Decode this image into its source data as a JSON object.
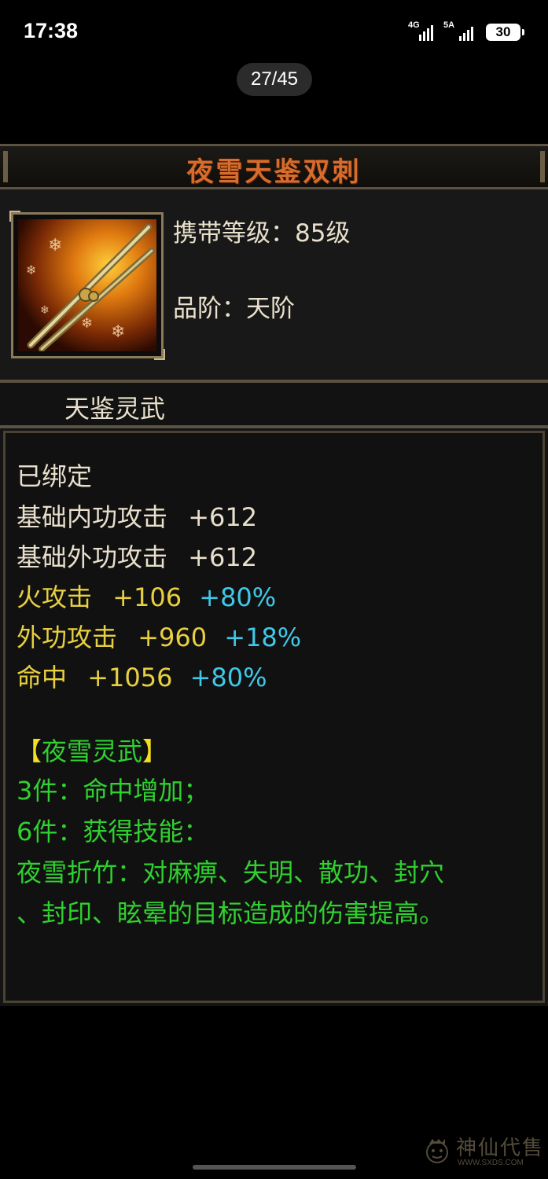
{
  "status_bar": {
    "time": "17:38",
    "signal1_label": "4G",
    "signal2_label": "5A",
    "battery": "30"
  },
  "viewer": {
    "counter": "27/45"
  },
  "item": {
    "name": "夜雪天鉴双刺",
    "icon": "twin-daggers-icon",
    "level_line": "携带等级：85级",
    "grade_line": "品阶：天阶",
    "category": "天鉴灵武",
    "bound": "已绑定",
    "stats": [
      {
        "label": "基础内功攻击",
        "value": "+612",
        "bonus": ""
      },
      {
        "label": "基础外功攻击",
        "value": "+612",
        "bonus": ""
      },
      {
        "label": "火攻击",
        "value": "+106",
        "bonus": "+80%"
      },
      {
        "label": "外功攻击",
        "value": "+960",
        "bonus": "+18%"
      },
      {
        "label": "命中",
        "value": "+1056",
        "bonus": "+80%"
      }
    ],
    "set": {
      "open_bracket": "【",
      "name": "夜雪灵武",
      "close_bracket": "】",
      "bonus3": "3件：命中增加；",
      "bonus6": "6件：获得技能：",
      "skill_line1": "夜雪折竹：对麻痹、失明、散功、封穴",
      "skill_line2": "、封印、眩晕的目标造成的伤害提高。"
    }
  },
  "watermark": {
    "text": "神仙代售",
    "url": "WWW.SXDS.COM"
  },
  "colors": {
    "title": "#d86c2c",
    "normal_text": "#e8e0cc",
    "yellow_attr": "#e8d040",
    "cyan_bonus": "#40c8e8",
    "green_set": "#30d030",
    "frame": "#5c5242"
  }
}
